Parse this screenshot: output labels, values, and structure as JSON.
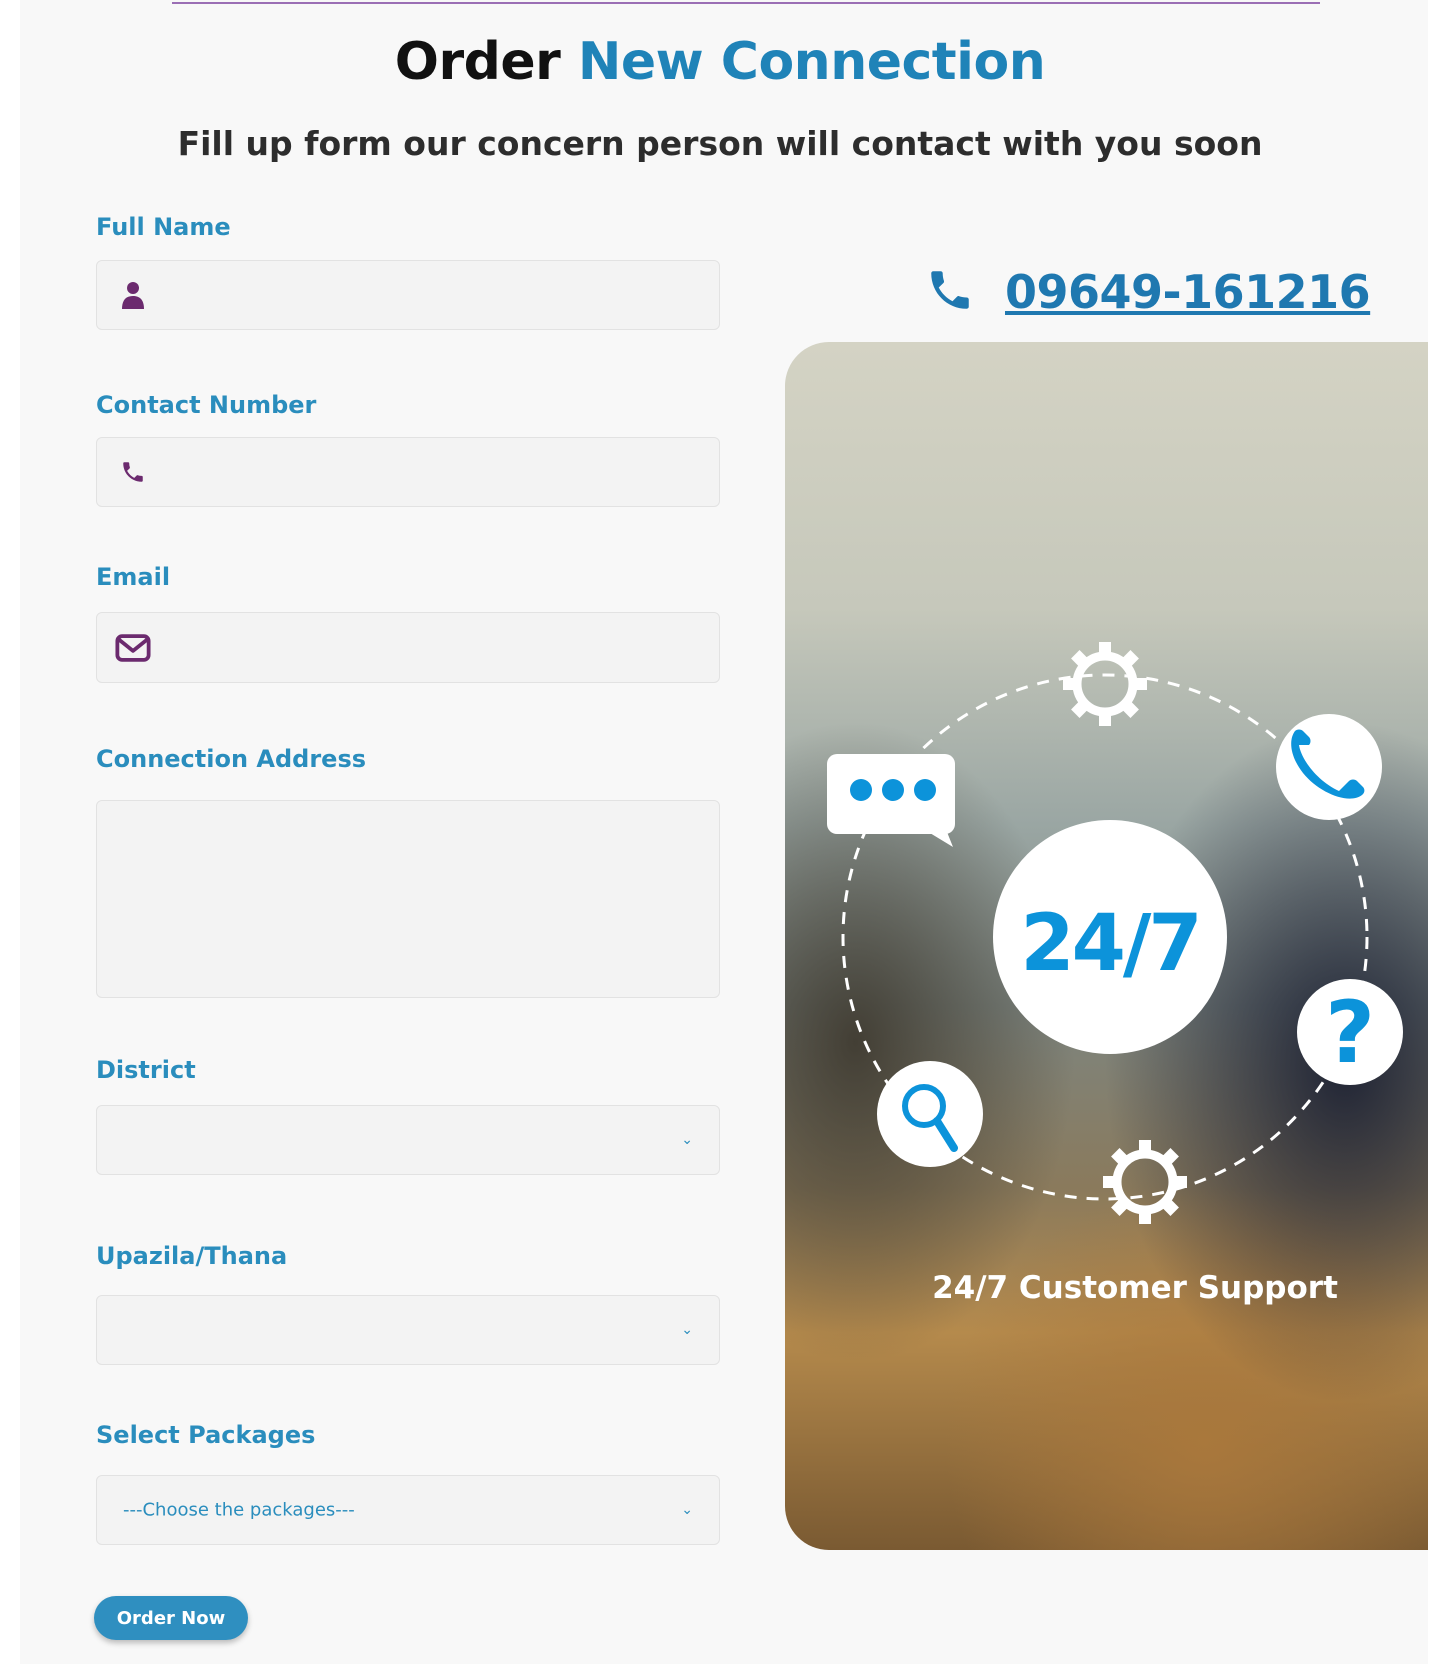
{
  "header": {
    "title_part1": "Order",
    "title_part2": "New Connection",
    "subtitle": "Fill up form our concern person will contact with you soon"
  },
  "form": {
    "full_name": {
      "label": "Full Name",
      "icon": "user-icon",
      "value": ""
    },
    "contact_number": {
      "label": "Contact Number",
      "icon": "phone-icon",
      "value": ""
    },
    "email": {
      "label": "Email",
      "icon": "envelope-icon",
      "value": ""
    },
    "connection_address": {
      "label": "Connection Address",
      "value": ""
    },
    "district": {
      "label": "District",
      "selected": ""
    },
    "upazila": {
      "label": "Upazila/Thana",
      "selected": ""
    },
    "packages": {
      "label": "Select Packages",
      "selected": "---Choose the packages---"
    },
    "submit_label": "Order Now"
  },
  "contact": {
    "phone": "09649-161216",
    "support_label": "24/7 Customer Support",
    "badge": "24/7"
  },
  "colors": {
    "accent": "#1f83b8",
    "label": "#2a8dbd",
    "icon": "#6b2a6e",
    "button": "#2f8fc0",
    "badge_blue": "#0c93da"
  }
}
